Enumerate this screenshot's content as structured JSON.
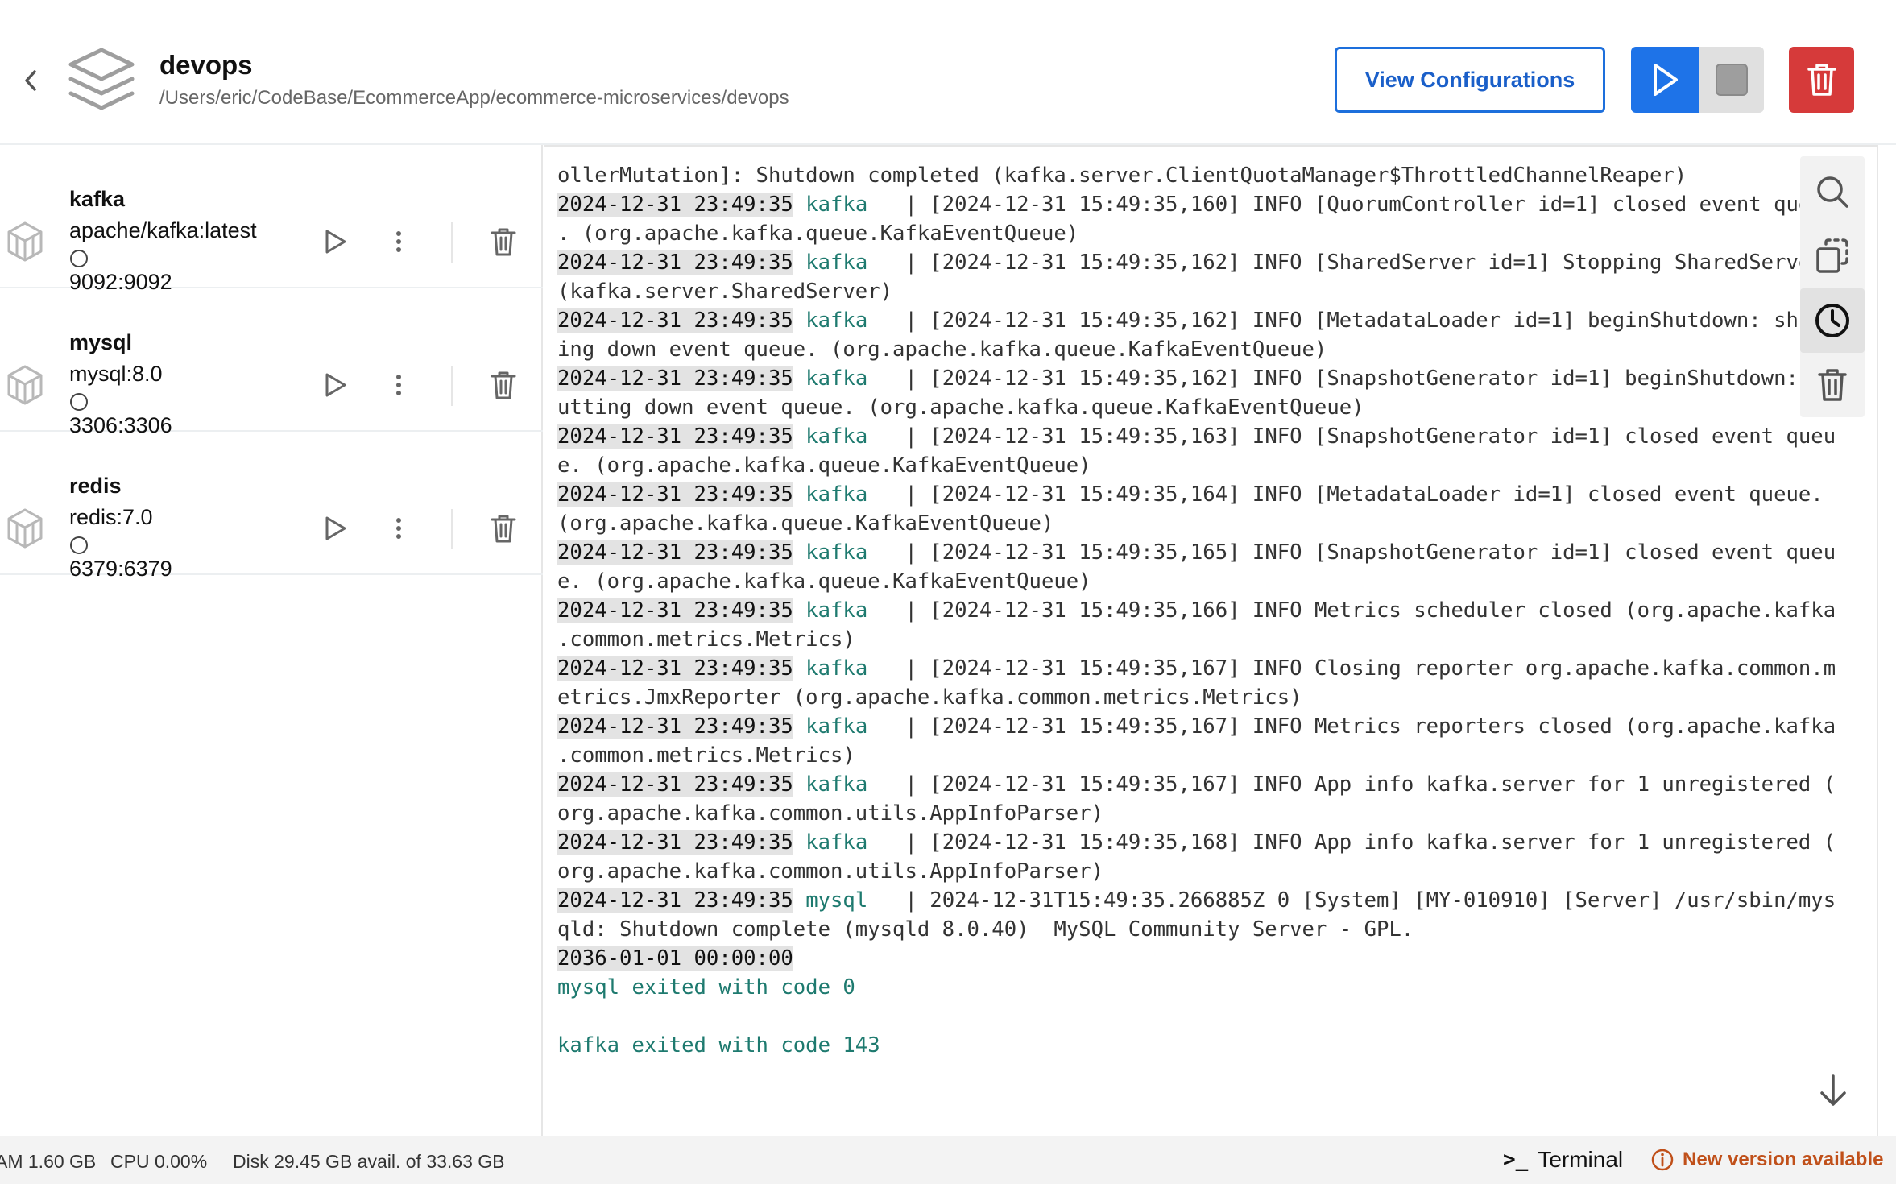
{
  "header": {
    "title": "devops",
    "path": "/Users/eric/CodeBase/EcommerceApp/ecommerce-microservices/devops",
    "view_config_label": "View Configurations"
  },
  "colors": {
    "accent": "#1e73e8",
    "danger": "#d63a3a",
    "log_service": "#1e7a6f",
    "update": "#c0501a"
  },
  "services": [
    {
      "name": "kafka",
      "image": "apache/kafka:latest",
      "port": "9092:9092"
    },
    {
      "name": "mysql",
      "image": "mysql:8.0",
      "port": "3306:3306"
    },
    {
      "name": "redis",
      "image": "redis:7.0",
      "port": "6379:6379"
    }
  ],
  "logs": {
    "lines": [
      {
        "ts": "",
        "svc": "",
        "msg": "ollerMutation]: Shutdown completed (kafka.server.ClientQuotaManager$ThrottledChannelReaper)"
      },
      {
        "ts": "2024-12-31 23:49:35",
        "svc": " kafka  ",
        "msg": " | [2024-12-31 15:49:35,160] INFO [QuorumController id=1] closed event queue"
      },
      {
        "ts": "",
        "svc": "",
        "msg": ". (org.apache.kafka.queue.KafkaEventQueue)"
      },
      {
        "ts": "2024-12-31 23:49:35",
        "svc": " kafka  ",
        "msg": " | [2024-12-31 15:49:35,162] INFO [SharedServer id=1] Stopping SharedServer"
      },
      {
        "ts": "",
        "svc": "",
        "msg": "(kafka.server.SharedServer)"
      },
      {
        "ts": "2024-12-31 23:49:35",
        "svc": " kafka  ",
        "msg": " | [2024-12-31 15:49:35,162] INFO [MetadataLoader id=1] beginShutdown: shutt"
      },
      {
        "ts": "",
        "svc": "",
        "msg": "ing down event queue. (org.apache.kafka.queue.KafkaEventQueue)"
      },
      {
        "ts": "2024-12-31 23:49:35",
        "svc": " kafka  ",
        "msg": " | [2024-12-31 15:49:35,162] INFO [SnapshotGenerator id=1] beginShutdown: sh"
      },
      {
        "ts": "",
        "svc": "",
        "msg": "utting down event queue. (org.apache.kafka.queue.KafkaEventQueue)"
      },
      {
        "ts": "2024-12-31 23:49:35",
        "svc": " kafka  ",
        "msg": " | [2024-12-31 15:49:35,163] INFO [SnapshotGenerator id=1] closed event queu"
      },
      {
        "ts": "",
        "svc": "",
        "msg": "e. (org.apache.kafka.queue.KafkaEventQueue)"
      },
      {
        "ts": "2024-12-31 23:49:35",
        "svc": " kafka  ",
        "msg": " | [2024-12-31 15:49:35,164] INFO [MetadataLoader id=1] closed event queue."
      },
      {
        "ts": "",
        "svc": "",
        "msg": "(org.apache.kafka.queue.KafkaEventQueue)"
      },
      {
        "ts": "2024-12-31 23:49:35",
        "svc": " kafka  ",
        "msg": " | [2024-12-31 15:49:35,165] INFO [SnapshotGenerator id=1] closed event queu"
      },
      {
        "ts": "",
        "svc": "",
        "msg": "e. (org.apache.kafka.queue.KafkaEventQueue)"
      },
      {
        "ts": "2024-12-31 23:49:35",
        "svc": " kafka  ",
        "msg": " | [2024-12-31 15:49:35,166] INFO Metrics scheduler closed (org.apache.kafka"
      },
      {
        "ts": "",
        "svc": "",
        "msg": ".common.metrics.Metrics)"
      },
      {
        "ts": "2024-12-31 23:49:35",
        "svc": " kafka  ",
        "msg": " | [2024-12-31 15:49:35,167] INFO Closing reporter org.apache.kafka.common.m"
      },
      {
        "ts": "",
        "svc": "",
        "msg": "etrics.JmxReporter (org.apache.kafka.common.metrics.Metrics)"
      },
      {
        "ts": "2024-12-31 23:49:35",
        "svc": " kafka  ",
        "msg": " | [2024-12-31 15:49:35,167] INFO Metrics reporters closed (org.apache.kafka"
      },
      {
        "ts": "",
        "svc": "",
        "msg": ".common.metrics.Metrics)"
      },
      {
        "ts": "2024-12-31 23:49:35",
        "svc": " kafka  ",
        "msg": " | [2024-12-31 15:49:35,167] INFO App info kafka.server for 1 unregistered ("
      },
      {
        "ts": "",
        "svc": "",
        "msg": "org.apache.kafka.common.utils.AppInfoParser)"
      },
      {
        "ts": "2024-12-31 23:49:35",
        "svc": " kafka  ",
        "msg": " | [2024-12-31 15:49:35,168] INFO App info kafka.server for 1 unregistered ("
      },
      {
        "ts": "",
        "svc": "",
        "msg": "org.apache.kafka.common.utils.AppInfoParser)"
      },
      {
        "ts": "2024-12-31 23:49:35",
        "svc": " mysql  ",
        "msg": " | 2024-12-31T15:49:35.266885Z 0 [System] [MY-010910] [Server] /usr/sbin/mys"
      },
      {
        "ts": "",
        "svc": "",
        "msg": "qld: Shutdown complete (mysqld 8.0.40)  MySQL Community Server - GPL."
      },
      {
        "ts": "2036-01-01 00:00:00",
        "svc": "",
        "msg": ""
      },
      {
        "ts": "",
        "svc": "",
        "msg": "",
        "exit": "mysql exited with code 0"
      },
      {
        "ts": "",
        "svc": "",
        "msg": ""
      },
      {
        "ts": "",
        "svc": "",
        "msg": "",
        "exit": "kafka exited with code 143"
      }
    ]
  },
  "statusbar": {
    "ram": "AM 1.60 GB",
    "cpu": "CPU 0.00%",
    "disk": "Disk 29.45 GB avail. of 33.63 GB",
    "terminal_label": "Terminal",
    "update_label": "New version available"
  },
  "icons": {
    "back": "chevron-left-icon",
    "stack": "layers-icon",
    "service": "cube-icon",
    "play": "play-icon",
    "stop": "stop-icon",
    "delete": "trash-icon",
    "more": "more-vertical-icon",
    "search": "search-icon",
    "copy": "copy-icon",
    "timestamp": "clock-icon",
    "scroll": "arrow-down-icon",
    "terminal": "terminal-icon",
    "info": "info-icon"
  }
}
